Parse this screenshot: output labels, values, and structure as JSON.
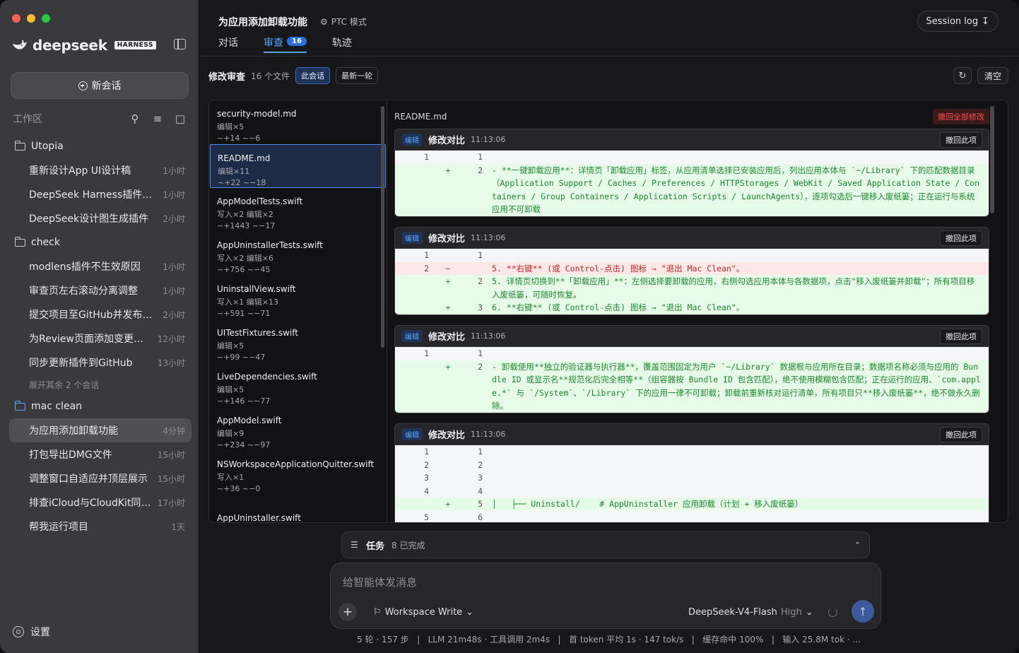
{
  "brand": {
    "name": "deepseek",
    "tag": "HARNESS"
  },
  "sidebar": {
    "new_chat": "新会话",
    "workspace_label": "工作区",
    "folders": [
      {
        "name": "Utopia",
        "items": [
          {
            "name": "重新设计App UI设计稿",
            "time": "1小时"
          },
          {
            "name": "DeepSeek Harness插件配...",
            "time": "1小时"
          },
          {
            "name": "DeepSeek设计图生成插件",
            "time": "2小时"
          }
        ]
      },
      {
        "name": "check",
        "items": [
          {
            "name": "modlens插件不生效原因",
            "time": "1小时"
          },
          {
            "name": "审查页左右滚动分离调整",
            "time": "1小时"
          },
          {
            "name": "提交项目至GitHub并发布0....",
            "time": "2小时"
          },
          {
            "name": "为Review页面添加变更撤...",
            "time": "12小时"
          },
          {
            "name": "同步更新插件到GitHub",
            "time": "13小时"
          }
        ],
        "more": "展开其余 2 个会话"
      },
      {
        "name": "mac clean",
        "items": [
          {
            "name": "为应用添加卸载功能",
            "time": "4分钟"
          },
          {
            "name": "打包导出DMG文件",
            "time": "15小时"
          },
          {
            "name": "调整窗口自适应并顶层展示",
            "time": "15小时"
          },
          {
            "name": "排查iCloud与CloudKit同步...",
            "time": "17小时"
          },
          {
            "name": "帮我运行项目",
            "time": "1天"
          }
        ]
      }
    ],
    "settings": "设置"
  },
  "header": {
    "title": "为应用添加卸载功能",
    "mode": "PTC 模式",
    "tabs": [
      {
        "label": "对话"
      },
      {
        "label": "审查",
        "badge": "16"
      },
      {
        "label": "轨迹"
      }
    ],
    "session_log": "Session log"
  },
  "review": {
    "title": "修改审查",
    "count": "16 个文件",
    "chip_session": "此会话",
    "chip_latest": "最新一轮",
    "clear": "清空",
    "files": [
      {
        "name": "security-model.md",
        "ops": "编辑×5",
        "diff": "~+14 ~−6"
      },
      {
        "name": "README.md",
        "ops": "编辑×11",
        "diff": "~+22 ~−18"
      },
      {
        "name": "AppModelTests.swift",
        "ops": "写入×2 编辑×2",
        "diff": "~+1443 ~−17"
      },
      {
        "name": "AppUninstallerTests.swift",
        "ops": "写入×2 编辑×6",
        "diff": "~+756 ~−45"
      },
      {
        "name": "UninstallView.swift",
        "ops": "写入×1 编辑×13",
        "diff": "~+591 ~−71"
      },
      {
        "name": "UITestFixtures.swift",
        "ops": "编辑×5",
        "diff": "~+99 ~−47"
      },
      {
        "name": "LiveDependencies.swift",
        "ops": "编辑×5",
        "diff": "~+146 ~−77"
      },
      {
        "name": "AppModel.swift",
        "ops": "编辑×9",
        "diff": "~+234 ~−97"
      },
      {
        "name": "NSWorkspaceApplicationQuitter.swift",
        "ops": "写入×1",
        "diff": "~+36 ~−0"
      },
      {
        "name": "AppUninstaller.swift",
        "ops": "",
        "diff": ""
      }
    ],
    "current_file": "README.md",
    "revert_all": "撤回全部修改",
    "hunk_tag": "编辑",
    "hunk_title": "修改对比",
    "hunk_revert": "撤回此项",
    "hunks": [
      {
        "time": "11:13:06",
        "lines": [
          {
            "t": "ctx",
            "o": "1",
            "s": "",
            "n": "1",
            "c": ""
          },
          {
            "t": "add",
            "o": "",
            "s": "+",
            "n": "2",
            "c": "- **一键卸载应用**：详情页「卸载应用」标签，从应用清单选择已安装应用后，列出应用本体与 `~/Library` 下的匹配数据目录（Application Support / Caches / Preferences / HTTPStorages / WebKit / Saved Application State / Containers / Group Containers / Application Scripts / LaunchAgents），逐项勾选后一键移入废纸篓；正在运行与系统应用不可卸载"
          }
        ]
      },
      {
        "time": "11:13:06",
        "lines": [
          {
            "t": "ctx",
            "o": "1",
            "s": "",
            "n": "1",
            "c": ""
          },
          {
            "t": "del",
            "o": "2",
            "s": "−",
            "n": "",
            "c": "5. **右键** (或 Control-点击) 图标 → \"退出 Mac Clean\"。"
          },
          {
            "t": "add",
            "o": "",
            "s": "+",
            "n": "2",
            "c": "5. 详情页切换到**「卸载应用」**：左侧选择要卸载的应用，右侧勾选应用本体与各数据项，点击\"移入废纸篓并卸载\"；所有项目移入废纸篓，可随时恢复。"
          },
          {
            "t": "add",
            "o": "",
            "s": "+",
            "n": "3",
            "c": "6. **右键** (或 Control-点击) 图标 → \"退出 Mac Clean\"。"
          }
        ]
      },
      {
        "time": "11:13:06",
        "lines": [
          {
            "t": "ctx",
            "o": "1",
            "s": "",
            "n": "1",
            "c": ""
          },
          {
            "t": "add",
            "o": "",
            "s": "+",
            "n": "2",
            "c": "- 卸载使用**独立的验证器与执行器**，覆盖范围固定为用户 `~/Library` 数据根与应用所在目录；数据项名称必须与应用的 Bundle ID 或显示名**规范化后完全相等**（组容器按 Bundle ID 包含匹配），绝不使用模糊包含匹配；正在运行的应用、`com.apple.*` 与 `/System`、`/Library` 下的应用一律不可卸载；卸载前重新核对运行清单，所有项目只**移入废纸篓**，绝不做永久删除。"
          }
        ]
      },
      {
        "time": "11:13:06",
        "lines": [
          {
            "t": "ctx",
            "o": "1",
            "s": "",
            "n": "1",
            "c": ""
          },
          {
            "t": "ctx",
            "o": "2",
            "s": "",
            "n": "2",
            "c": ""
          },
          {
            "t": "ctx",
            "o": "3",
            "s": "",
            "n": "3",
            "c": ""
          },
          {
            "t": "ctx",
            "o": "4",
            "s": "",
            "n": "4",
            "c": ""
          },
          {
            "t": "add",
            "o": "",
            "s": "+",
            "n": "5",
            "c": "│   ├── Uninstall/    # AppUninstaller 应用卸载（计划 + 移入废纸篓）"
          },
          {
            "t": "ctx",
            "o": "5",
            "s": "",
            "n": "6",
            "c": ""
          }
        ]
      }
    ]
  },
  "tasks": {
    "label": "任务",
    "status": "8 已完成"
  },
  "composer": {
    "placeholder": "给智能体发消息",
    "permission": "Workspace Write",
    "model": "DeepSeek-V4-Flash",
    "level": "High"
  },
  "status_line": "5 轮 · 157 步   |   LLM 21m48s · 工具调用 2m4s   |   首 token 平均 1s · 147 tok/s   |   缓存命中 100%   |   输入 25.8M tok · ..."
}
